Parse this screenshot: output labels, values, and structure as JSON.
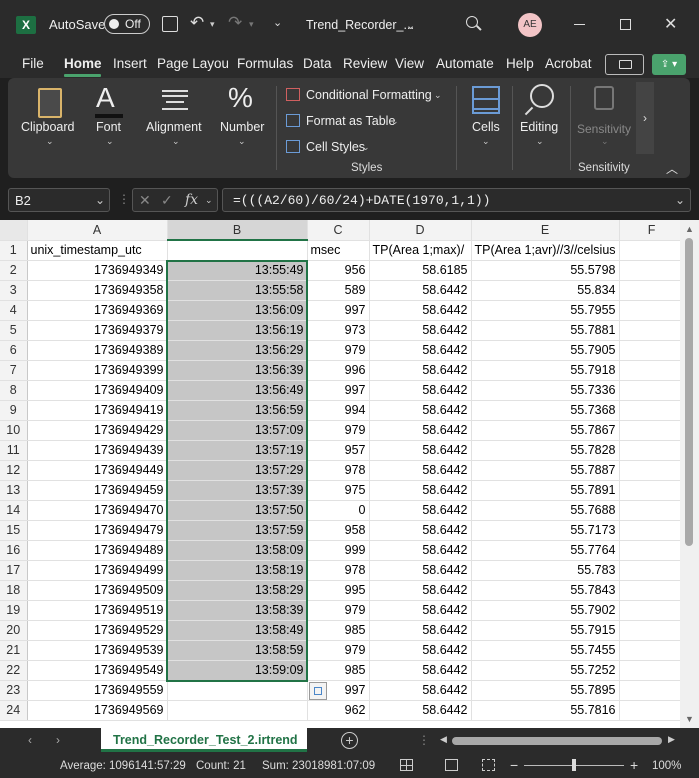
{
  "titlebar": {
    "autosave_label": "AutoSave",
    "autosave_state": "Off",
    "file_title": "Trend_Recorder_...",
    "avatar_initials": "AE"
  },
  "menu": [
    "File",
    "Home",
    "Insert",
    "Page Layout",
    "Formulas",
    "Data",
    "Review",
    "View",
    "Automate",
    "Help",
    "Acrobat"
  ],
  "ribbon": {
    "clipboard": "Clipboard",
    "font": "Font",
    "alignment": "Alignment",
    "number": "Number",
    "cond_format": "Conditional Formatting",
    "format_table": "Format as Table",
    "cell_styles": "Cell Styles",
    "styles_group": "Styles",
    "cells": "Cells",
    "editing": "Editing",
    "sensitivity": "Sensitivity",
    "sensitivity_group": "Sensitivity"
  },
  "formula_bar": {
    "name_box": "B2",
    "fx": "fx",
    "formula": "=(((A2/60)/60/24)+DATE(1970,1,1))"
  },
  "columns": [
    "A",
    "B",
    "C",
    "D",
    "E",
    "F"
  ],
  "header_row": [
    "unix_timestamp_utc",
    "",
    "msec",
    "TP(Area 1;max)/",
    "TP(Area 1;avr)//3//celsius",
    ""
  ],
  "rows": [
    {
      "n": "2",
      "a": "1736949349",
      "b": "13:55:49",
      "c": "956",
      "d": "58.6185",
      "e": "55.5798"
    },
    {
      "n": "3",
      "a": "1736949358",
      "b": "13:55:58",
      "c": "589",
      "d": "58.6442",
      "e": "55.834"
    },
    {
      "n": "4",
      "a": "1736949369",
      "b": "13:56:09",
      "c": "997",
      "d": "58.6442",
      "e": "55.7955"
    },
    {
      "n": "5",
      "a": "1736949379",
      "b": "13:56:19",
      "c": "973",
      "d": "58.6442",
      "e": "55.7881"
    },
    {
      "n": "6",
      "a": "1736949389",
      "b": "13:56:29",
      "c": "979",
      "d": "58.6442",
      "e": "55.7905"
    },
    {
      "n": "7",
      "a": "1736949399",
      "b": "13:56:39",
      "c": "996",
      "d": "58.6442",
      "e": "55.7918"
    },
    {
      "n": "8",
      "a": "1736949409",
      "b": "13:56:49",
      "c": "997",
      "d": "58.6442",
      "e": "55.7336"
    },
    {
      "n": "9",
      "a": "1736949419",
      "b": "13:56:59",
      "c": "994",
      "d": "58.6442",
      "e": "55.7368"
    },
    {
      "n": "10",
      "a": "1736949429",
      "b": "13:57:09",
      "c": "979",
      "d": "58.6442",
      "e": "55.7867"
    },
    {
      "n": "11",
      "a": "1736949439",
      "b": "13:57:19",
      "c": "957",
      "d": "58.6442",
      "e": "55.7828"
    },
    {
      "n": "12",
      "a": "1736949449",
      "b": "13:57:29",
      "c": "978",
      "d": "58.6442",
      "e": "55.7887"
    },
    {
      "n": "13",
      "a": "1736949459",
      "b": "13:57:39",
      "c": "975",
      "d": "58.6442",
      "e": "55.7891"
    },
    {
      "n": "14",
      "a": "1736949470",
      "b": "13:57:50",
      "c": "0",
      "d": "58.6442",
      "e": "55.7688"
    },
    {
      "n": "15",
      "a": "1736949479",
      "b": "13:57:59",
      "c": "958",
      "d": "58.6442",
      "e": "55.7173"
    },
    {
      "n": "16",
      "a": "1736949489",
      "b": "13:58:09",
      "c": "999",
      "d": "58.6442",
      "e": "55.7764"
    },
    {
      "n": "17",
      "a": "1736949499",
      "b": "13:58:19",
      "c": "978",
      "d": "58.6442",
      "e": "55.783"
    },
    {
      "n": "18",
      "a": "1736949509",
      "b": "13:58:29",
      "c": "995",
      "d": "58.6442",
      "e": "55.7843"
    },
    {
      "n": "19",
      "a": "1736949519",
      "b": "13:58:39",
      "c": "979",
      "d": "58.6442",
      "e": "55.7902"
    },
    {
      "n": "20",
      "a": "1736949529",
      "b": "13:58:49",
      "c": "985",
      "d": "58.6442",
      "e": "55.7915"
    },
    {
      "n": "21",
      "a": "1736949539",
      "b": "13:58:59",
      "c": "979",
      "d": "58.6442",
      "e": "55.7455"
    },
    {
      "n": "22",
      "a": "1736949549",
      "b": "13:59:09",
      "c": "985",
      "d": "58.6442",
      "e": "55.7252"
    },
    {
      "n": "23",
      "a": "1736949559",
      "b": "",
      "c": "997",
      "d": "58.6442",
      "e": "55.7895"
    },
    {
      "n": "24",
      "a": "1736949569",
      "b": "",
      "c": "962",
      "d": "58.6442",
      "e": "55.7816"
    }
  ],
  "sheet_tab": "Trend_Recorder_Test_2.irtrend",
  "status": {
    "average": "Average: 1096141:57:29",
    "count": "Count: 21",
    "sum": "Sum: 23018981:07:09",
    "zoom": "100%"
  },
  "colors": {
    "accent": "#217346",
    "selection": "#c6c6c6"
  }
}
